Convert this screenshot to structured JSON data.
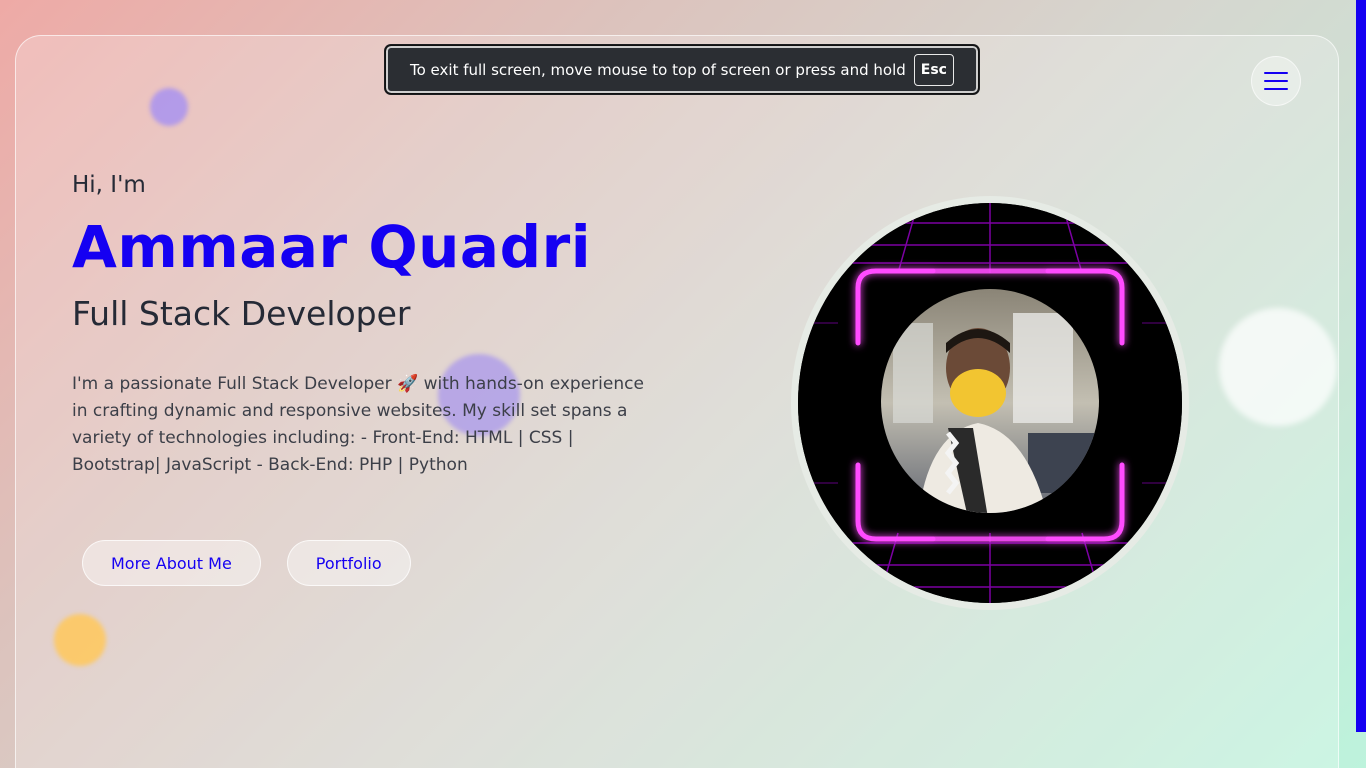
{
  "fullscreen_notice": {
    "message": "To exit full screen, move mouse to top of screen or press and hold",
    "key": "Esc"
  },
  "header": {
    "menu_icon": "hamburger-menu-icon"
  },
  "hero": {
    "greeting": "Hi, I'm",
    "name": "Ammaar Quadri",
    "role": "Full Stack Developer",
    "bio": "I'm a passionate Full Stack Developer 🚀 with hands-on experience in crafting dynamic and responsive websites. My skill set spans a variety of technologies including: - Front-End: HTML | CSS | Bootstrap| JavaScript - Back-End: PHP | Python"
  },
  "actions": {
    "more_about_label": "More About Me",
    "portfolio_label": "Portfolio"
  },
  "colors": {
    "accent": "#1500f2",
    "text_dark": "#252a36",
    "neon_frame": "#ff3bff",
    "grid": "#a000c8"
  }
}
